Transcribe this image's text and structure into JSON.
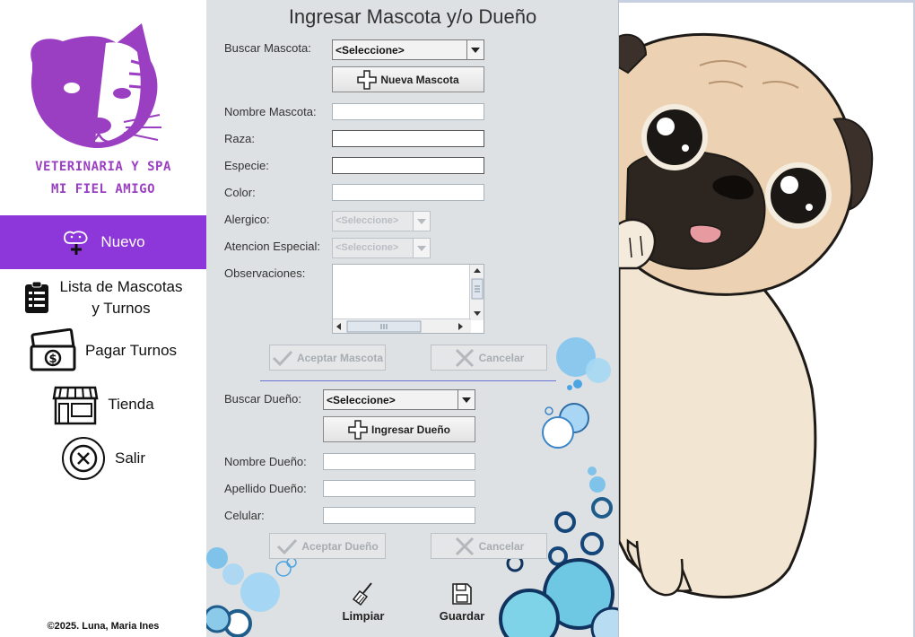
{
  "sidebar": {
    "brand_line1": "VETERINARIA Y SPA",
    "brand_line2": "MI FIEL AMIGO",
    "items": [
      {
        "label": "Nuevo",
        "icon": "pet-add-icon"
      },
      {
        "label_line1": "Lista de Mascotas",
        "label_line2": "y Turnos",
        "icon": "clipboard-list-icon"
      },
      {
        "label": "Pagar Turnos",
        "icon": "money-icon"
      },
      {
        "label": "Tienda",
        "icon": "store-icon"
      },
      {
        "label": "Salir",
        "icon": "close-circle-icon"
      }
    ],
    "footer": "©2025. Luna, Maria Ines"
  },
  "form": {
    "title": "Ingresar Mascota y/o Dueño",
    "pet": {
      "search_label": "Buscar Mascota:",
      "search_value": "<Seleccione>",
      "new_button": "Nueva Mascota",
      "name_label": "Nombre Mascota:",
      "breed_label": "Raza:",
      "species_label": "Especie:",
      "color_label": "Color:",
      "allergic_label": "Alergico:",
      "allergic_value": "<Seleccione>",
      "special_label": "Atencion Especial:",
      "special_value": "<Seleccione>",
      "observations_label": "Observaciones:",
      "accept_button": "Aceptar Mascota",
      "cancel_button": "Cancelar"
    },
    "owner": {
      "search_label": "Buscar Dueño:",
      "search_value": "<Seleccione>",
      "new_button": "Ingresar Dueño",
      "name_label": "Nombre Dueño:",
      "surname_label": "Apellido Dueño:",
      "phone_label": "Celular:",
      "accept_button": "Aceptar Dueño",
      "cancel_button": "Cancelar"
    },
    "toolbar": {
      "clear_label": "Limpiar",
      "save_label": "Guardar"
    }
  },
  "colors": {
    "accent": "#8d36d9",
    "brand_text": "#9b3fc2",
    "panel_bg": "#dde1e3"
  }
}
